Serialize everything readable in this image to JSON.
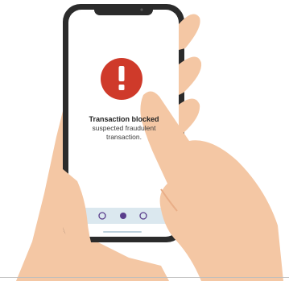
{
  "alert": {
    "icon": "exclamation-icon",
    "title": "Transaction blocked",
    "line1": "suspected fraudulent",
    "line2": "transaction."
  },
  "pagination": {
    "dots": [
      "empty",
      "filled",
      "empty"
    ],
    "active_index": 1
  },
  "colors": {
    "alert_red": "#cf3a2a",
    "skin": "#f4c7a4",
    "skin_shadow": "#e9ae87",
    "phone_frame": "#2b2b2b",
    "screen": "#ffffff",
    "pager_bar": "#dbe8ef",
    "dot_active": "#5a3e8c"
  }
}
